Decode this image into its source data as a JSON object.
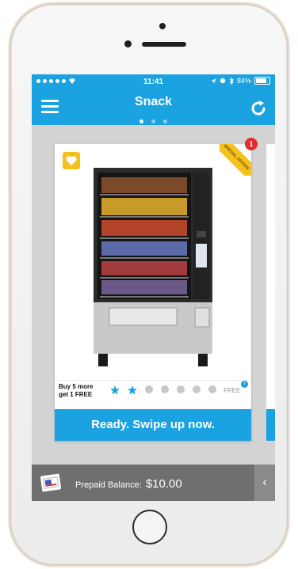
{
  "status": {
    "carrier_dots": "•••••",
    "time": "11:41",
    "battery_percent": "84%"
  },
  "navbar": {
    "title": "Snack",
    "page_count": 3,
    "active_page": 0
  },
  "card": {
    "offer_badge_text": "SPECIAL OFFERS",
    "offer_count": "1",
    "promo_line1": "Buy 5 more",
    "promo_line2": "get 1 FREE",
    "stamps_total": 7,
    "stamps_filled": 2,
    "free_label": "FREE",
    "info_icon": "i",
    "action_label": "Ready. Swipe up now."
  },
  "balance": {
    "label": "Prepaid Balance:",
    "amount": "$10.00",
    "collapse_glyph": "‹"
  },
  "colors": {
    "accent": "#1ba2e0",
    "badge_yellow": "#f4c21c",
    "badge_red": "#e02c2c",
    "balance_bar": "#6f6f6f"
  }
}
